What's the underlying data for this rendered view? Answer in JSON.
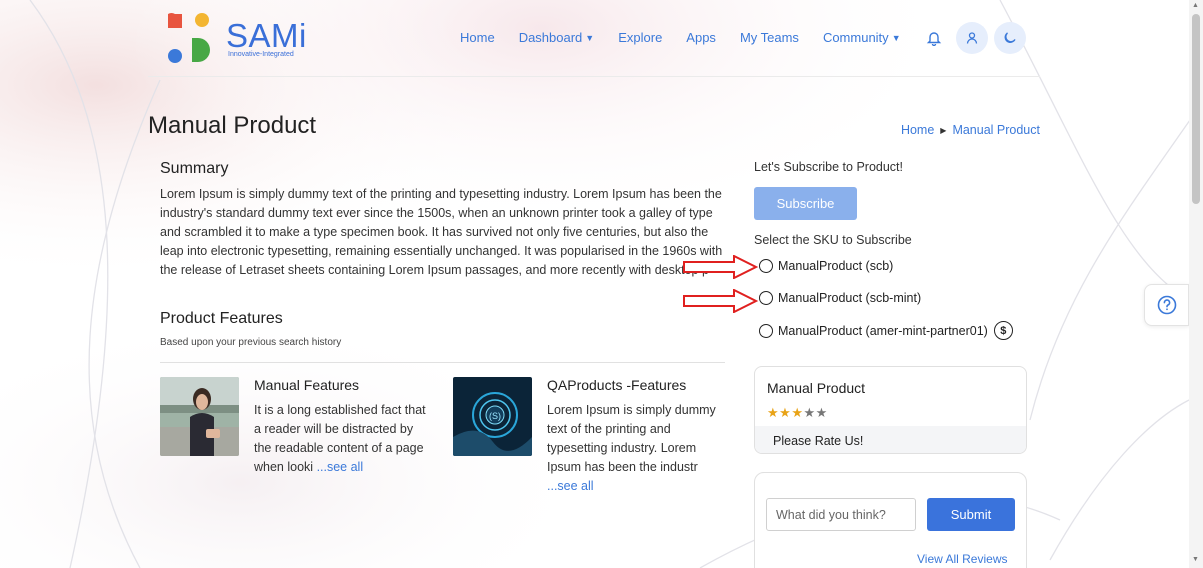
{
  "brand": {
    "name": "SAMi",
    "tagline": "Innovative-Integrated"
  },
  "nav": {
    "items": [
      {
        "label": "Home",
        "has_dropdown": false
      },
      {
        "label": "Dashboard",
        "has_dropdown": true
      },
      {
        "label": "Explore",
        "has_dropdown": false
      },
      {
        "label": "Apps",
        "has_dropdown": false
      },
      {
        "label": "My Teams",
        "has_dropdown": false
      },
      {
        "label": "Community",
        "has_dropdown": true
      }
    ],
    "icons": [
      "bell-icon",
      "user-icon",
      "moon-icon"
    ]
  },
  "page": {
    "title": "Manual Product",
    "breadcrumb": [
      "Home",
      "Manual Product"
    ]
  },
  "summary": {
    "heading": "Summary",
    "text": "Lorem Ipsum is simply dummy text of the printing and typesetting industry. Lorem Ipsum has been the industry's standard dummy text ever since the 1500s, when an unknown printer took a galley of type and scrambled it to make a type specimen book. It has survived not only five centuries, but also the leap into electronic typesetting, remaining essentially unchanged. It was popularised in the 1960s with the release of Letraset sheets containing Lorem Ipsum passages, and more recently with desktop p"
  },
  "features": {
    "heading": "Product Features",
    "subtitle": "Based upon your previous search history",
    "see_all_label": "...see all",
    "items": [
      {
        "title": "Manual Features",
        "desc": "It is a long established fact that a reader will be distracted by the readable content of a page when looki"
      },
      {
        "title": "QAProducts -Features",
        "desc": "Lorem Ipsum is simply dummy text of the printing and typesetting industry. Lorem Ipsum has been the industr"
      }
    ]
  },
  "subscribe": {
    "prompt": "Let's Subscribe to Product!",
    "button_label": "Subscribe",
    "sku_prompt": "Select the SKU to Subscribe",
    "skus": [
      {
        "label": "ManualProduct (scb)",
        "arrow": true,
        "paid": false
      },
      {
        "label": "ManualProduct (scb-mint)",
        "arrow": true,
        "paid": false
      },
      {
        "label": "ManualProduct (amer-mint-partner01)",
        "arrow": false,
        "paid": true
      }
    ]
  },
  "rating": {
    "title": "Manual Product",
    "stars_filled": 3,
    "stars_total": 5,
    "prompt": "Please Rate Us!"
  },
  "review": {
    "placeholder": "What did you think?",
    "submit_label": "Submit",
    "view_all_label": "View All Reviews"
  },
  "colors": {
    "accent": "#3b79d9",
    "subscribe_button": "#8ab0ec",
    "submit_button": "#3a73dc",
    "arrow": "#e0201f",
    "star": "#e8a317"
  }
}
